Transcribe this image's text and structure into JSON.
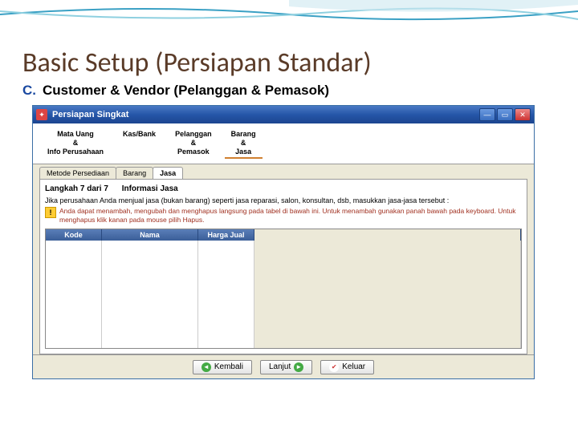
{
  "slide": {
    "title": "Basic Setup (Persiapan Standar)",
    "list_letter": "C.",
    "subtitle": "Customer & Vendor (Pelanggan & Pemasok)"
  },
  "window": {
    "title": "Persiapan Singkat",
    "steps": [
      {
        "label": "Mata Uang\n&\nInfo Perusahaan"
      },
      {
        "label": "Kas/Bank"
      },
      {
        "label": "Pelanggan\n&\nPemasok"
      },
      {
        "label": "Barang\n&\nJasa"
      }
    ],
    "subtabs": [
      "Metode Persediaan",
      "Barang",
      "Jasa"
    ],
    "step_label": "Langkah 7 dari 7",
    "step_info": "Informasi Jasa",
    "desc": "Jika perusahaan Anda menjual jasa (bukan barang) seperti jasa reparasi, salon, konsultan, dsb, masukkan jasa-jasa tersebut :",
    "warn": "Anda dapat menambah, mengubah dan menghapus langsung pada tabel di bawah ini. Untuk menambah gunakan panah bawah pada keyboard. Untuk menghapus klik kanan pada mouse pilih Hapus.",
    "columns": [
      "Kode",
      "Nama",
      "Harga Jual"
    ],
    "buttons": {
      "back": "Kembali",
      "next": "Lanjut",
      "exit": "Keluar"
    }
  }
}
